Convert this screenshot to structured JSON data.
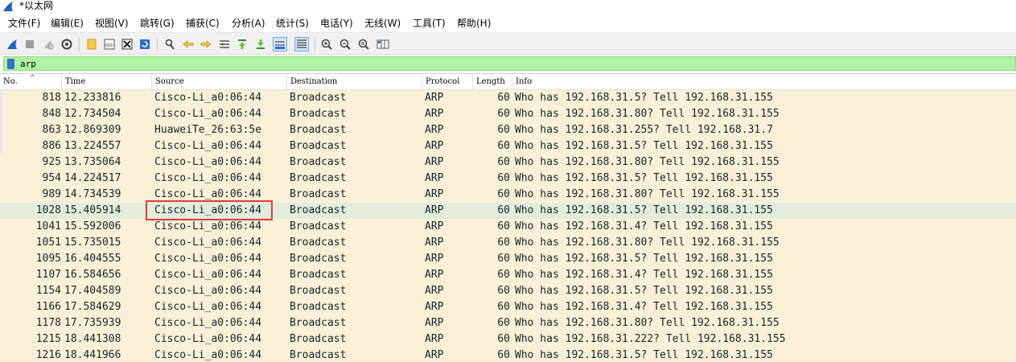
{
  "window": {
    "title": "*以太网"
  },
  "menu": [
    "文件(F)",
    "编辑(E)",
    "视图(V)",
    "跳转(G)",
    "捕获(C)",
    "分析(A)",
    "统计(S)",
    "电话(Y)",
    "无线(W)",
    "工具(T)",
    "帮助(H)"
  ],
  "toolbar": {
    "buttons": [
      "shark-fin-start-icon",
      "stop-icon",
      "restart-icon",
      "options-gear-icon",
      "open-folder-icon",
      "binary-file-icon",
      "close-file-icon",
      "reload-icon",
      "find-icon",
      "back-arrow-icon",
      "forward-arrow-icon",
      "go-to-packet-icon",
      "first-packet-icon",
      "last-packet-icon",
      "auto-scroll-icon",
      "colorize-icon",
      "zoom-in-icon",
      "zoom-out-icon",
      "zoom-normal-icon",
      "resize-columns-icon"
    ]
  },
  "filter": {
    "value": "arp",
    "bg_color": "#aff3a4"
  },
  "columns": [
    "No.",
    "Time",
    "Source",
    "Destination",
    "Protocol",
    "Length",
    "Info"
  ],
  "packets": [
    {
      "no": "818",
      "time": "12.233816",
      "source": "Cisco-Li_a0:06:44",
      "destination": "Broadcast",
      "protocol": "ARP",
      "length": "60",
      "info": "Who has 192.168.31.5? Tell 192.168.31.155"
    },
    {
      "no": "848",
      "time": "12.734504",
      "source": "Cisco-Li_a0:06:44",
      "destination": "Broadcast",
      "protocol": "ARP",
      "length": "60",
      "info": "Who has 192.168.31.80? Tell 192.168.31.155"
    },
    {
      "no": "863",
      "time": "12.869309",
      "source": "HuaweiTe_26:63:5e",
      "destination": "Broadcast",
      "protocol": "ARP",
      "length": "60",
      "info": "Who has 192.168.31.255? Tell 192.168.31.7"
    },
    {
      "no": "886",
      "time": "13.224557",
      "source": "Cisco-Li_a0:06:44",
      "destination": "Broadcast",
      "protocol": "ARP",
      "length": "60",
      "info": "Who has 192.168.31.5? Tell 192.168.31.155"
    },
    {
      "no": "925",
      "time": "13.735064",
      "source": "Cisco-Li_a0:06:44",
      "destination": "Broadcast",
      "protocol": "ARP",
      "length": "60",
      "info": "Who has 192.168.31.80? Tell 192.168.31.155"
    },
    {
      "no": "954",
      "time": "14.224517",
      "source": "Cisco-Li_a0:06:44",
      "destination": "Broadcast",
      "protocol": "ARP",
      "length": "60",
      "info": "Who has 192.168.31.5? Tell 192.168.31.155"
    },
    {
      "no": "989",
      "time": "14.734539",
      "source": "Cisco-Li_a0:06:44",
      "destination": "Broadcast",
      "protocol": "ARP",
      "length": "60",
      "info": "Who has 192.168.31.80? Tell 192.168.31.155"
    },
    {
      "no": "1028",
      "time": "15.405914",
      "source": "Cisco-Li_a0:06:44",
      "destination": "Broadcast",
      "protocol": "ARP",
      "length": "60",
      "info": "Who has 192.168.31.5? Tell 192.168.31.155",
      "selected": true
    },
    {
      "no": "1041",
      "time": "15.592006",
      "source": "Cisco-Li_a0:06:44",
      "destination": "Broadcast",
      "protocol": "ARP",
      "length": "60",
      "info": "Who has 192.168.31.4? Tell 192.168.31.155"
    },
    {
      "no": "1051",
      "time": "15.735015",
      "source": "Cisco-Li_a0:06:44",
      "destination": "Broadcast",
      "protocol": "ARP",
      "length": "60",
      "info": "Who has 192.168.31.80? Tell 192.168.31.155"
    },
    {
      "no": "1095",
      "time": "16.404555",
      "source": "Cisco-Li_a0:06:44",
      "destination": "Broadcast",
      "protocol": "ARP",
      "length": "60",
      "info": "Who has 192.168.31.5? Tell 192.168.31.155"
    },
    {
      "no": "1107",
      "time": "16.584656",
      "source": "Cisco-Li_a0:06:44",
      "destination": "Broadcast",
      "protocol": "ARP",
      "length": "60",
      "info": "Who has 192.168.31.4? Tell 192.168.31.155"
    },
    {
      "no": "1154",
      "time": "17.404589",
      "source": "Cisco-Li_a0:06:44",
      "destination": "Broadcast",
      "protocol": "ARP",
      "length": "60",
      "info": "Who has 192.168.31.5? Tell 192.168.31.155"
    },
    {
      "no": "1166",
      "time": "17.584629",
      "source": "Cisco-Li_a0:06:44",
      "destination": "Broadcast",
      "protocol": "ARP",
      "length": "60",
      "info": "Who has 192.168.31.4? Tell 192.168.31.155"
    },
    {
      "no": "1178",
      "time": "17.735939",
      "source": "Cisco-Li_a0:06:44",
      "destination": "Broadcast",
      "protocol": "ARP",
      "length": "60",
      "info": "Who has 192.168.31.80? Tell 192.168.31.155"
    },
    {
      "no": "1215",
      "time": "18.441308",
      "source": "Cisco-Li_a0:06:44",
      "destination": "Broadcast",
      "protocol": "ARP",
      "length": "60",
      "info": "Who has 192.168.31.222? Tell 192.168.31.155"
    },
    {
      "no": "1216",
      "time": "18.441966",
      "source": "Cisco-Li_a0:06:44",
      "destination": "Broadcast",
      "protocol": "ARP",
      "length": "60",
      "info": "Who has 192.168.31.5? Tell 192.168.31.155"
    }
  ],
  "colors": {
    "arp_row_bg": "#faf0d7",
    "selected_row_bg": "#e3ecdc",
    "highlight_border": "#e23a3a"
  }
}
